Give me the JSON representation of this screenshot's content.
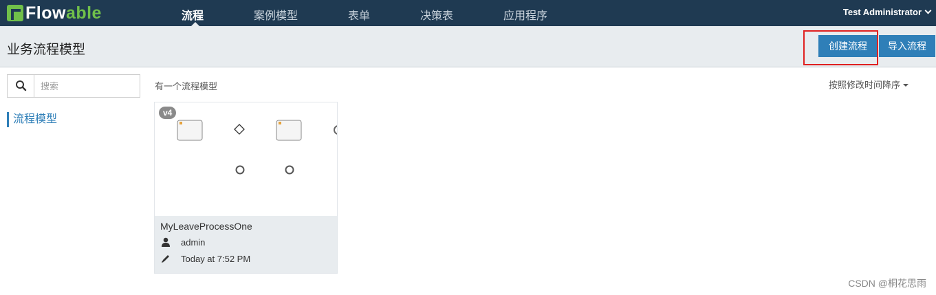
{
  "brand": {
    "logo_text_a": "Flow",
    "logo_text_b": "able"
  },
  "nav": {
    "items": [
      "流程",
      "案例模型",
      "表单",
      "决策表",
      "应用程序"
    ],
    "active": "流程"
  },
  "user": {
    "name": "Test Administrator"
  },
  "header": {
    "title": "业务流程模型",
    "create_label": "创建流程",
    "import_label": "导入流程"
  },
  "sidebar": {
    "search_placeholder": "搜索",
    "items": [
      "流程模型"
    ]
  },
  "main": {
    "count_text": "有一个流程模型",
    "sort_label": "按照修改时间降序",
    "models": [
      {
        "version": "v4",
        "name": "MyLeaveProcessOne",
        "owner": "admin",
        "modified": "Today at 7:52 PM"
      }
    ]
  },
  "watermark": "CSDN @桐花思雨",
  "colors": {
    "topbar": "#1f3a52",
    "brand_green": "#70c04a",
    "primary": "#2f7fb8",
    "subheader": "#e8ecef",
    "highlight": "#e02020"
  }
}
